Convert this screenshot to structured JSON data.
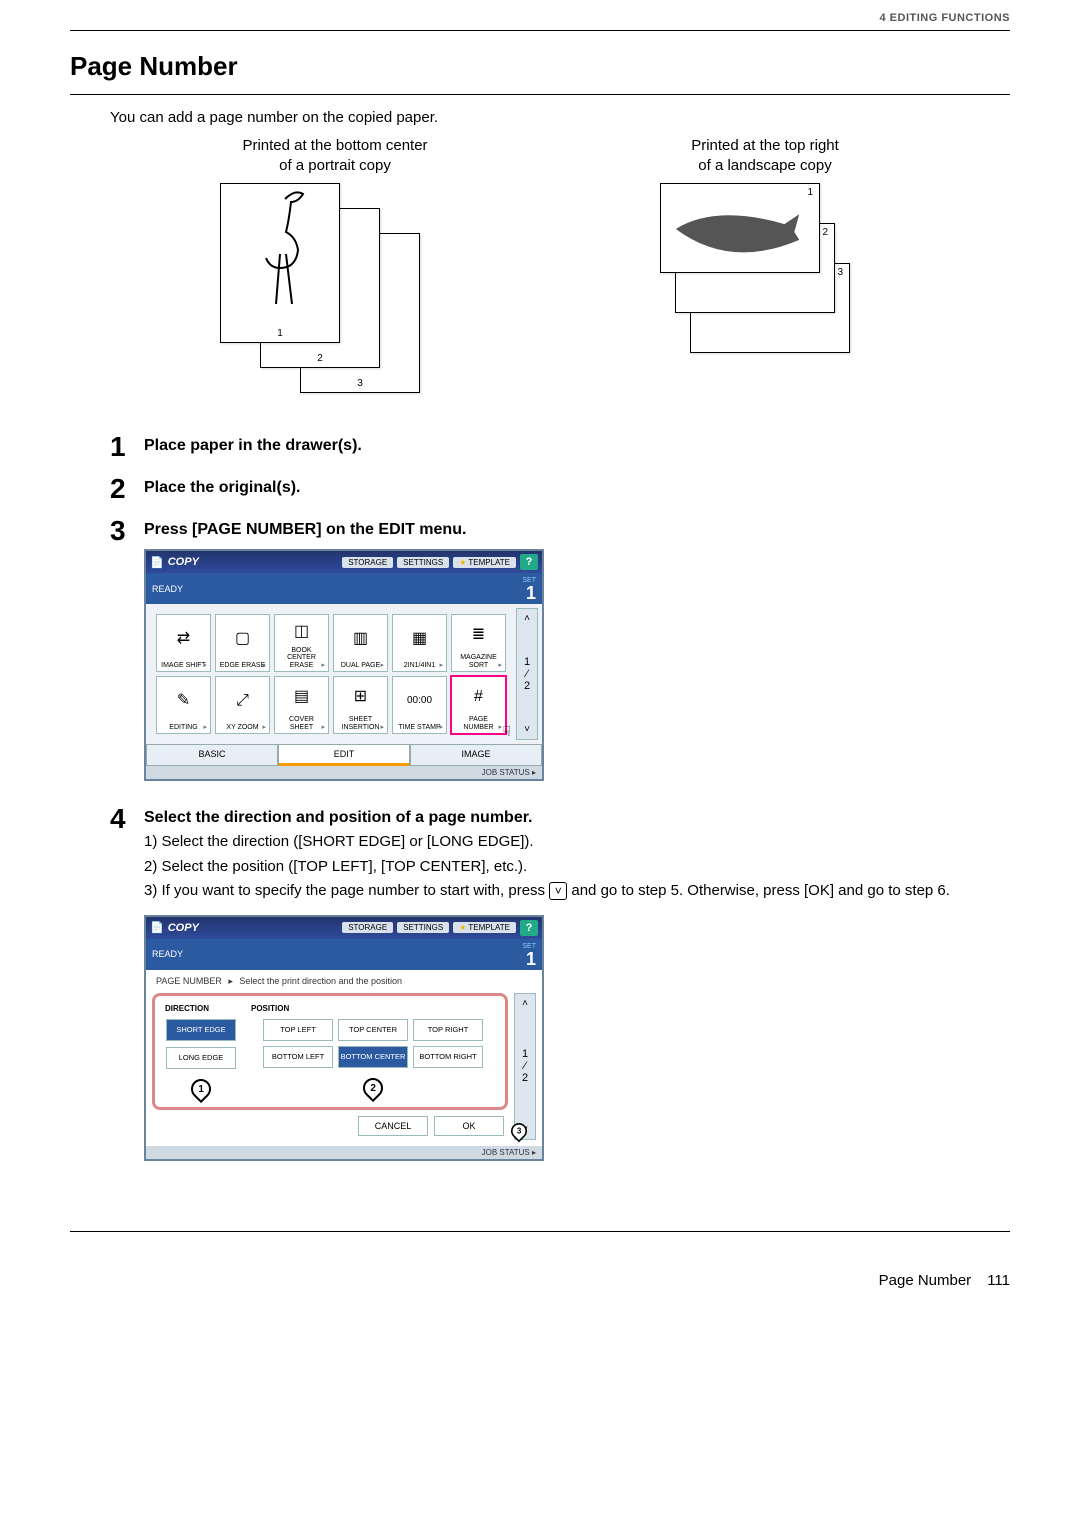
{
  "header": {
    "breadcrumb": "4 EDITING FUNCTIONS"
  },
  "chapter_tab": "4",
  "title": "Page Number",
  "intro": "You can add a page number on the copied paper.",
  "illus": {
    "left_caption_l1": "Printed at the bottom center",
    "left_caption_l2": "of a portrait copy",
    "right_caption_l1": "Printed at the top right",
    "right_caption_l2": "of a landscape copy",
    "nums": [
      "1",
      "2",
      "3"
    ]
  },
  "steps": [
    {
      "num": "1",
      "title": "Place paper in the drawer(s)."
    },
    {
      "num": "2",
      "title": "Place the original(s)."
    },
    {
      "num": "3",
      "title": "Press [PAGE NUMBER] on the EDIT menu."
    },
    {
      "num": "4",
      "title": "Select the direction and position of a page number.",
      "subs": [
        "1)  Select the direction ([SHORT EDGE] or [LONG EDGE]).",
        "2)  Select the position ([TOP LEFT], [TOP CENTER], etc.).",
        "3)  If you want to specify the page number to start with, press",
        "and go to step 5. Otherwise, press [OK] and go to step 6."
      ]
    }
  ],
  "shot_common": {
    "copy_label": "COPY",
    "storage": "STORAGE",
    "settings": "SETTINGS",
    "template": "TEMPLATE",
    "help": "?",
    "ready": "READY",
    "set": "SET",
    "set_num": "1",
    "job_status": "JOB STATUS",
    "tabs": {
      "basic": "BASIC",
      "edit": "EDIT",
      "image": "IMAGE"
    }
  },
  "shot1": {
    "cells_row1": [
      "IMAGE SHIFT",
      "EDGE ERASE",
      "BOOK CENTER ERASE",
      "DUAL PAGE",
      "2IN1/4IN1",
      "MAGAZINE SORT"
    ],
    "cells_row2": [
      "EDITING",
      "XY ZOOM",
      "COVER SHEET",
      "SHEET INSERTION",
      "TIME STAMP",
      "PAGE NUMBER"
    ],
    "time_icon": "00:00",
    "side": {
      "up": "˄",
      "one": "1",
      "slash": "⁄",
      "two": "2",
      "down": "˅"
    }
  },
  "shot2": {
    "breadcrumb_left": "PAGE NUMBER",
    "breadcrumb_right": "Select the print direction and the position",
    "direction_label": "DIRECTION",
    "position_label": "POSITION",
    "dir_buttons": [
      "SHORT EDGE",
      "LONG EDGE"
    ],
    "pos_buttons": [
      "TOP LEFT",
      "TOP CENTER",
      "TOP RIGHT",
      "BOTTOM LEFT",
      "BOTTOM CENTER",
      "BOTTOM RIGHT"
    ],
    "markers": [
      "1",
      "2",
      "3"
    ],
    "cancel": "CANCEL",
    "ok": "OK",
    "side": {
      "up": "˄",
      "one": "1",
      "slash": "⁄",
      "two": "2",
      "down": "˅"
    }
  },
  "footer": {
    "label": "Page Number",
    "page": "111"
  }
}
